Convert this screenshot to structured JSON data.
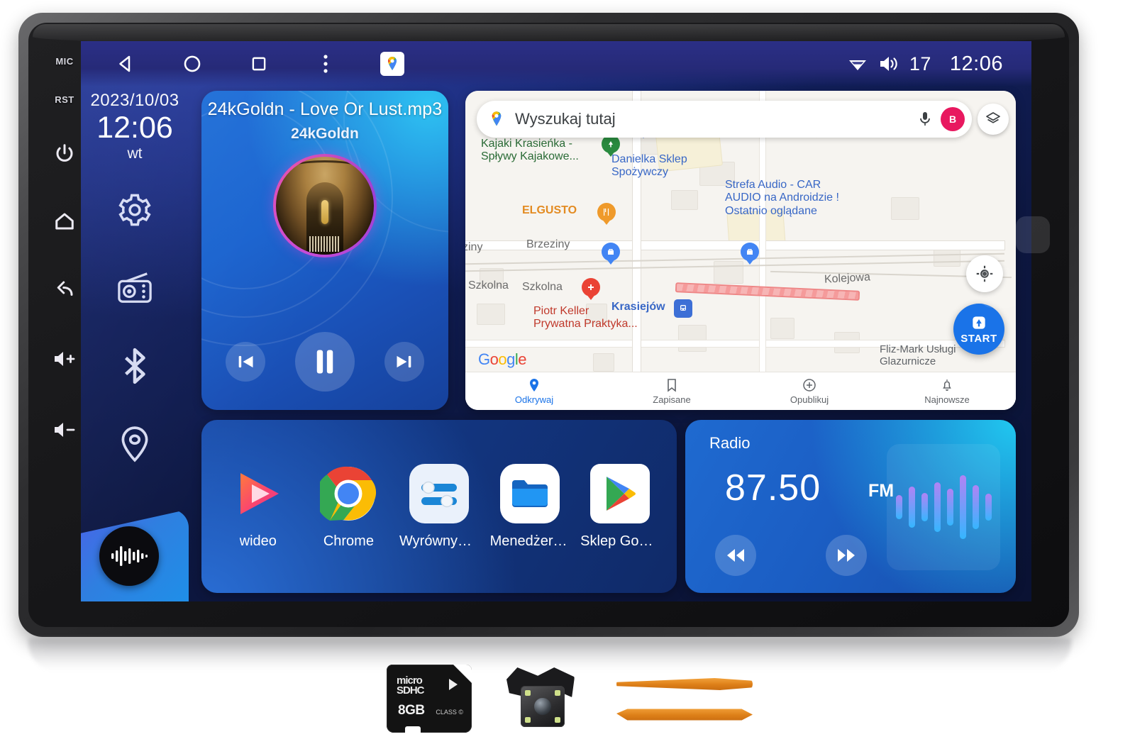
{
  "device": {
    "side_buttons": [
      {
        "name": "mic-label",
        "label": "MIC"
      },
      {
        "name": "reset-label",
        "label": "RST"
      },
      {
        "name": "power-button",
        "label": "power-icon"
      },
      {
        "name": "home-button",
        "label": "home-icon"
      },
      {
        "name": "back-button",
        "label": "back-icon"
      },
      {
        "name": "volume-up-button",
        "label": "volume-up-icon"
      },
      {
        "name": "volume-down-button",
        "label": "volume-down-icon"
      }
    ]
  },
  "statusbar": {
    "nav": [
      {
        "name": "android-back",
        "icon": "triangle-left-icon"
      },
      {
        "name": "android-home",
        "icon": "circle-icon"
      },
      {
        "name": "android-recents",
        "icon": "square-icon"
      },
      {
        "name": "android-overflow",
        "icon": "three-dots-icon"
      },
      {
        "name": "maps-shortcut",
        "icon": "google-maps-icon"
      }
    ],
    "wifi_icon": "wifi-icon",
    "volume_icon": "speaker-icon",
    "volume_level": "17",
    "clock": "12:06"
  },
  "dock": {
    "date": "2023/10/03",
    "time": "12:06",
    "weekday": "wt",
    "icons": [
      {
        "name": "settings",
        "icon": "gear-icon"
      },
      {
        "name": "radio",
        "icon": "radio-icon"
      },
      {
        "name": "bluetooth",
        "icon": "bluetooth-icon"
      },
      {
        "name": "navigation",
        "icon": "location-pin-icon"
      }
    ],
    "eq_icon": "equalizer-waveform-icon"
  },
  "music": {
    "title": "24kGoldn - Love Or Lust.mp3",
    "artist": "24kGoldn",
    "prev_label": "previous-track",
    "play_label": "pause",
    "next_label": "next-track"
  },
  "map": {
    "search_placeholder": "Wyszukaj tutaj",
    "mic_icon": "microphone-icon",
    "avatar_initial": "B",
    "layers_icon": "layers-icon",
    "mylocation_icon": "my-location-icon",
    "start_label": "START",
    "attribution": [
      "G",
      "o",
      "o",
      "g",
      "l",
      "e"
    ],
    "labels": [
      {
        "id": "kajaki",
        "text": "Kajaki Krasieńka -",
        "text2": "Spływy Kajakowe...",
        "color": "green"
      },
      {
        "id": "danielka",
        "text": "Danielka Sklep",
        "text2": "Spożywczy",
        "color": "blue"
      },
      {
        "id": "strefa",
        "text": "Strefa Audio - CAR",
        "text2": "AUDIO na Androidzie !",
        "sub": "Ostatnio oglądane",
        "color": "blue"
      },
      {
        "id": "elgusto",
        "text": "ELGUSTO",
        "color": "orange"
      },
      {
        "id": "piotr",
        "text": "Piotr Keller",
        "text2": "Prywatna Praktyka...",
        "color": "red"
      },
      {
        "id": "krasiejow",
        "text": "Krasiejów",
        "color": "blue"
      },
      {
        "id": "flizmark",
        "text": "Fliz-Mark Usługi",
        "text2": "Glazurnicze",
        "color": "gray"
      }
    ],
    "streets": [
      {
        "id": "brzeziny",
        "text": "Brzeziny"
      },
      {
        "id": "ziny",
        "text": "ziny"
      },
      {
        "id": "szkolna1",
        "text": "Szkolna"
      },
      {
        "id": "szkolna2",
        "text": "Szkolna"
      },
      {
        "id": "kolejowa",
        "text": "Kolejowa"
      }
    ],
    "bottom_nav": [
      {
        "name": "odkrywaj",
        "label": "Odkrywaj",
        "icon": "pin-icon",
        "active": true
      },
      {
        "name": "zapisane",
        "label": "Zapisane",
        "icon": "bookmark-icon",
        "active": false
      },
      {
        "name": "opublikuj",
        "label": "Opublikuj",
        "icon": "plus-circle-icon",
        "active": false
      },
      {
        "name": "najnowsze",
        "label": "Najnowsze",
        "icon": "bell-icon",
        "active": false
      }
    ]
  },
  "apps": [
    {
      "name": "wideo",
      "label": "wideo",
      "icon": "video-play-icon"
    },
    {
      "name": "chrome",
      "label": "Chrome",
      "icon": "chrome-icon"
    },
    {
      "name": "wyrownywanie",
      "label": "Wyrównywa...",
      "icon": "equalizer-sliders-icon"
    },
    {
      "name": "menedzer-plikow",
      "label": "Menedżer P...",
      "icon": "folder-icon"
    },
    {
      "name": "sklep-google",
      "label": "Sklep Googl...",
      "icon": "google-play-icon"
    }
  ],
  "radio": {
    "title": "Radio",
    "frequency": "87.50",
    "band": "FM",
    "prev_label": "seek-down",
    "next_label": "seek-up",
    "viz_heights": [
      34,
      58,
      40,
      70,
      52,
      90,
      62,
      38
    ]
  },
  "accessories": [
    {
      "name": "microsd-card",
      "capacity": "8GB",
      "brand": "microSDHC"
    },
    {
      "name": "rear-view-camera"
    },
    {
      "name": "pry-tools"
    }
  ],
  "colors": {
    "accent_blue": "#1a73e8",
    "widget_blue": "#1f6ad0",
    "screen_bg": "#12205f",
    "maps_pink": "#e8185f"
  }
}
